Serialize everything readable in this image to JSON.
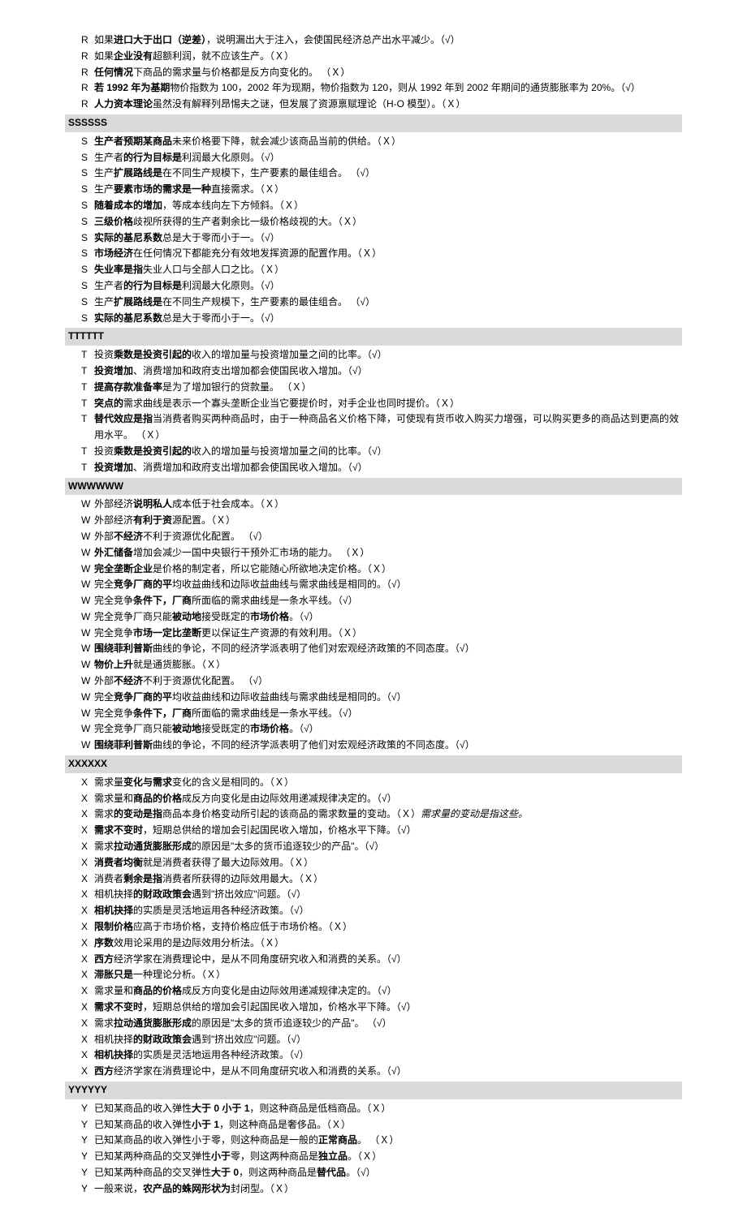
{
  "sections": [
    {
      "items": [
        {
          "p": "R",
          "t": "如果<b>进口大于出口（逆差）</b>，说明漏出大于注入，会使国民经济总产出水平减少。（√）"
        },
        {
          "p": "R",
          "t": "如果<b>企业没有</b>超额利润，就不应该生产。（Ｘ）"
        },
        {
          "p": "R",
          "t": "<b>任何情况</b>下商品的需求量与价格都是反方向变化的。 （Ｘ）"
        },
        {
          "p": "R",
          "t": "<b>若 1992 年为基期</b>物价指数为 100，2002 年为现期，物价指数为 120，则从 1992 年到 2002 年期间的通货膨胀率为 20%。（√）"
        },
        {
          "p": "R",
          "t": "<b>人力资本理论</b>虽然没有解释列昂惕夫之谜，但发展了资源禀赋理论（H-O 模型）。（Ｘ）"
        }
      ]
    },
    {
      "header": "SSSSSS",
      "items": [
        {
          "p": "S",
          "t": "<b>生产者预期某商品</b>未来价格要下降，就会减少该商品当前的供给。（Ｘ）"
        },
        {
          "p": "S",
          "t": "生产者<b>的行为目标是</b>利润最大化原则。（√）"
        },
        {
          "p": "S",
          "t": "生产<b>扩展路线是</b>在不同生产规模下，生产要素的最佳组合。 （√）"
        },
        {
          "p": "S",
          "t": "生产<b>要素市场的需求是一种</b>直接需求。（Ｘ）"
        },
        {
          "p": "S",
          "t": "<b>随着成本的增加</b>，等成本线向左下方倾斜。（Ｘ）"
        },
        {
          "p": "S",
          "t": "<b>三级价格</b>歧视所获得的生产者剩余比一级价格歧视的大。（Ｘ）"
        },
        {
          "p": "S",
          "t": "<b>实际的基尼系数</b>总是大于零而小于一。（√）"
        },
        {
          "p": "S",
          "t": "<b>市场经济</b>在任何情况下都能充分有效地发挥资源的配置作用。（Ｘ）"
        },
        {
          "p": "S",
          "t": "<b>失业率是指</b>失业人口与全部人口之比。（Ｘ）"
        },
        {
          "p": "S",
          "t": "生产者<b>的行为目标是</b>利润最大化原则。（√）"
        },
        {
          "p": "S",
          "t": "生产<b>扩展路线是</b>在不同生产规模下，生产要素的最佳组合。 （√）"
        },
        {
          "p": "S",
          "t": "<b>实际的基尼系数</b>总是大于零而小于一。（√）"
        }
      ]
    },
    {
      "header": "TTTTTT",
      "items": [
        {
          "p": "T",
          "t": "投资<b>乘数是投资引起的</b>收入的增加量与投资增加量之间的比率。（√）"
        },
        {
          "p": "T",
          "t": "<b>投资增加</b>、消费增加和政府支出增加都会使国民收入增加。（√）"
        },
        {
          "p": "T",
          "t": "<b>提高存款准备率</b>是为了增加银行的贷款量。 （Ｘ）"
        },
        {
          "p": "T",
          "t": "<b>突点的</b>需求曲线是表示一个寡头垄断企业当它要提价时，对手企业也同时提价。（Ｘ）"
        },
        {
          "p": "T",
          "t": "<b>替代效应是指</b>当消费者购买两种商品时，由于一种商品名义价格下降，可使现有货币收入购买力增强，可以购买更多的商品达到更高的效用水平。 （Ｘ）"
        },
        {
          "p": "T",
          "t": "投资<b>乘数是投资引起的</b>收入的增加量与投资增加量之间的比率。（√）"
        },
        {
          "p": "T",
          "t": "<b>投资增加</b>、消费增加和政府支出增加都会使国民收入增加。（√）"
        }
      ]
    },
    {
      "header": "WWWWWW",
      "items": [
        {
          "p": "W",
          "t": "外部经济<b>说明私人</b>成本低于社会成本。（Ｘ）"
        },
        {
          "p": "W",
          "t": "外部经济<b>有利于资</b>源配置。（Ｘ）"
        },
        {
          "p": "W",
          "t": "外部<b>不经济</b>不利于资源优化配置。 （√）"
        },
        {
          "p": "W",
          "t": "<b>外汇储备</b>增加会减少一国中央银行干预外汇市场的能力。 （Ｘ）"
        },
        {
          "p": "W",
          "t": "<b>完全垄断企业</b>是价格的制定者，所以它能随心所欲地决定价格。（Ｘ）"
        },
        {
          "p": "W",
          "t": "完全<b>竞争厂商的平</b>均收益曲线和边际收益曲线与需求曲线是相同的。（√）"
        },
        {
          "p": "W",
          "t": "完全竞争<b>条件下，厂商</b>所面临的需求曲线是一条水平线。（√）"
        },
        {
          "p": "W",
          "t": "完全竞争厂商只能<b>被动地</b>接受既定的<b>市场价格</b>。（√）"
        },
        {
          "p": "W",
          "t": "完全竞争<b>市场一定比垄断</b>更以保证生产资源的有效利用。（Ｘ）"
        },
        {
          "p": "W",
          "t": "<b>围绕菲利普斯</b>曲线的争论，不同的经济学派表明了他们对宏观经济政策的不同态度。（√）"
        },
        {
          "p": "W",
          "t": "<b>物价上升</b>就是通货膨胀。（Ｘ）"
        },
        {
          "p": "W",
          "t": "外部<b>不经济</b>不利于资源优化配置。 （√）"
        },
        {
          "p": "W",
          "t": "完全<b>竞争厂商的平</b>均收益曲线和边际收益曲线与需求曲线是相同的。（√）"
        },
        {
          "p": "W",
          "t": "完全竞争<b>条件下，厂商</b>所面临的需求曲线是一条水平线。（√）"
        },
        {
          "p": "W",
          "t": "完全竞争厂商只能<b>被动地</b>接受既定的<b>市场价格</b>。（√）"
        },
        {
          "p": "W",
          "t": "<b>围绕菲利普斯</b>曲线的争论，不同的经济学派表明了他们对宏观经济政策的不同态度。（√）"
        }
      ]
    },
    {
      "header": "XXXXXX",
      "items": [
        {
          "p": "X",
          "t": "需求量<b>变化与需求</b>变化的含义是相同的。（Ｘ）"
        },
        {
          "p": "X",
          "t": "需求量和<b>商品的价格</b>成反方向变化是由边际效用递减规律决定的。（√）"
        },
        {
          "p": "X",
          "t": "需求<b>的变动是指</b>商品本身价格变动所引起的该商品的需求数量的变动。（Ｘ）<span class='note'>需求量的变动是指这些。</span>"
        },
        {
          "p": "X",
          "t": "<b>需求不变时</b>，短期总供给的增加会引起国民收入增加，价格水平下降。（√）"
        },
        {
          "p": "X",
          "t": "需求<b>拉动通货膨胀形成</b>的原因是\"太多的货币追逐较少的产品\"。（√）"
        },
        {
          "p": "X",
          "t": "<b>消费者均衡</b>就是消费者获得了最大边际效用。（Ｘ）"
        },
        {
          "p": "X",
          "t": "消费者<b>剩余是指</b>消费者所获得的边际效用最大。（Ｘ）"
        },
        {
          "p": "X",
          "t": "相机抉择<b>的财政政策会</b>遇到\"挤出效应\"问题。（√）"
        },
        {
          "p": "X",
          "t": "<b>相机抉择</b>的实质是灵活地运用各种经济政策。（√）"
        },
        {
          "p": "X",
          "t": "<b>限制价格</b>应高于市场价格，支持价格应低于市场价格。（Ｘ）"
        },
        {
          "p": "X",
          "t": "<b>序数</b>效用论采用的是边际效用分析法。（Ｘ）"
        },
        {
          "p": "X",
          "t": "<b>西方</b>经济学家在消费理论中，是从不同角度研究收入和消费的关系。（√）"
        },
        {
          "p": "X",
          "t": "<b>滞胀只是</b>一种理论分析。（Ｘ）"
        },
        {
          "p": "X",
          "t": "需求量和<b>商品的价格</b>成反方向变化是由边际效用递减规律决定的。（√）"
        },
        {
          "p": "X",
          "t": "<b>需求不变时</b>，短期总供给的增加会引起国民收入增加，价格水平下降。（√）"
        },
        {
          "p": "X",
          "t": "需求<b>拉动通货膨胀形成</b>的原因是\"太多的货币追逐较少的产品\"。 （√）"
        },
        {
          "p": "X",
          "t": "相机抉择<b>的财政政策会</b>遇到\"挤出效应\"问题。（√）"
        },
        {
          "p": "X",
          "t": "<b>相机抉择</b>的实质是灵活地运用各种经济政策。（√）"
        },
        {
          "p": "X",
          "t": "<b>西方</b>经济学家在消费理论中，是从不同角度研究收入和消费的关系。（√）"
        }
      ]
    },
    {
      "header": "YYYYYY",
      "items": [
        {
          "p": "Y",
          "t": "已知某商品的收入弹性<b>大于 0 小于 1</b>，则这种商品是低档商品。（Ｘ）"
        },
        {
          "p": "Y",
          "t": "已知某商品的收入弹性<b>小于 1</b>，则这种商品是奢侈品。（Ｘ）"
        },
        {
          "p": "Y",
          "t": "已知某商品的收入弹性小于零，则这种商品是一般的<b>正常商品</b>。 （Ｘ）"
        },
        {
          "p": "Y",
          "t": "已知某两种商品的交叉弹性<b>小于</b>零，则这两种商品是<b>独立品</b>。（Ｘ）"
        },
        {
          "p": "Y",
          "t": "已知某两种商品的交叉弹性<b>大于 0</b>，则这两种商品是<b>替代品</b>。（√）"
        },
        {
          "p": "Y",
          "t": "一般来说，<b>农产品的蛛网形状为</b>封闭型。（Ｘ）"
        }
      ]
    }
  ]
}
